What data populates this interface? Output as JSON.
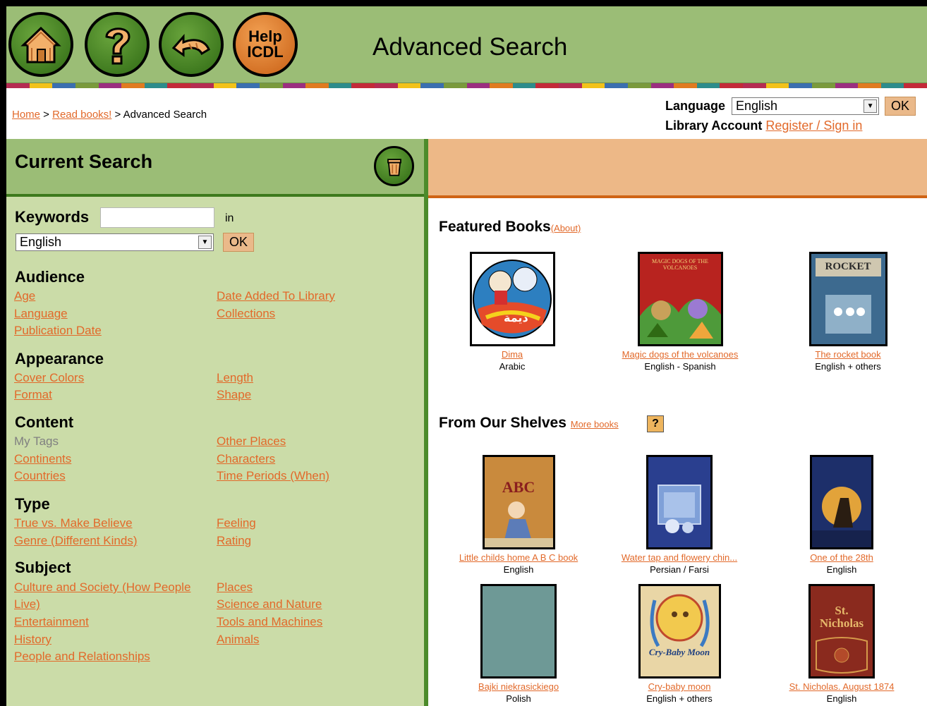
{
  "header": {
    "title": "Advanced Search",
    "help_line1": "Help",
    "help_line2": "ICDL"
  },
  "stripe_colors": [
    "#b52c52",
    "#f2c21a",
    "#3b6fb0",
    "#7a9a3c",
    "#9b2f80",
    "#e07b20",
    "#2d8c8c",
    "#c32a39"
  ],
  "breadcrumb": {
    "home": "Home",
    "sep1": " > ",
    "read": "Read books!",
    "sep2": " > ",
    "current": "Advanced Search"
  },
  "topbar": {
    "language_label": "Language",
    "language_value": "English",
    "ok": "OK",
    "account_label": "Library Account",
    "account_link": "Register / Sign in"
  },
  "left": {
    "current_search": "Current Search",
    "keywords_label": "Keywords",
    "keywords_value": "",
    "in_label": "in",
    "kw_language": "English",
    "ok": "OK",
    "facets": {
      "audience": {
        "title": "Audience",
        "col1": [
          "Age",
          "Language",
          "Publication Date"
        ],
        "col2": [
          "Date Added To Library",
          "Collections"
        ]
      },
      "appearance": {
        "title": "Appearance",
        "col1": [
          "Cover Colors",
          "Format"
        ],
        "col2": [
          "Length",
          "Shape"
        ]
      },
      "content": {
        "title": "Content",
        "col1": [
          "My Tags",
          "Continents",
          "Countries"
        ],
        "col2": [
          "Other Places",
          "Characters",
          "Time Periods (When)"
        ]
      },
      "type": {
        "title": "Type",
        "col1": [
          "True vs. Make Believe",
          "Genre (Different Kinds)"
        ],
        "col2": [
          "Feeling",
          "Rating"
        ]
      },
      "subject": {
        "title": "Subject",
        "col1a": "Culture and Society (How People",
        "col1b": "Live)",
        "col1": [
          "Entertainment",
          "History",
          "People and Relationships"
        ],
        "col2": [
          "Places",
          "Science and Nature",
          "Tools and Machines",
          "Animals"
        ]
      }
    }
  },
  "right": {
    "featured_title": "Featured Books",
    "featured_about": "(About)",
    "featured": [
      {
        "title": "Dima",
        "lang": "Arabic"
      },
      {
        "title": "Magic dogs of the volcanoes",
        "lang": "English - Spanish",
        "cover_text": "MAGIC DOGS OF THE VOLCANOES"
      },
      {
        "title": "The rocket book",
        "lang": "English + others",
        "cover_text": "ROCKET"
      }
    ],
    "shelves_title": "From Our Shelves",
    "more_books": "More books",
    "help_q": "?",
    "shelves": [
      {
        "title": "Little childs home A B C book",
        "lang": "English",
        "cover_text": "ABC"
      },
      {
        "title": "Water tap and flowery chin...",
        "lang": "Persian / Farsi"
      },
      {
        "title": "One of the 28th",
        "lang": "English"
      },
      {
        "title": "Bajki niekrasickiego",
        "lang": "Polish"
      },
      {
        "title": "Cry-baby moon",
        "lang": "English + others",
        "cover_text": "Cry-Baby Moon"
      },
      {
        "title": "St. Nicholas. August 1874",
        "lang": "English",
        "cover_text": "St. Nicholas"
      }
    ]
  }
}
